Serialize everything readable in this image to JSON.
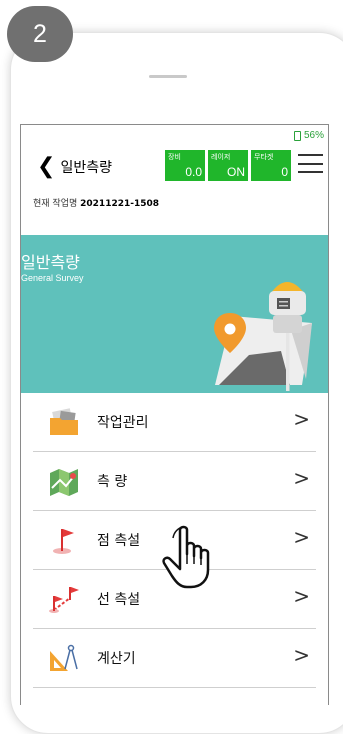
{
  "step_number": "2",
  "battery": {
    "percent": "56%"
  },
  "header": {
    "title": "일반측량",
    "back_icon": "chevron-left-icon",
    "menu_icon": "hamburger-icon"
  },
  "status": [
    {
      "label": "장비",
      "value": "0.0"
    },
    {
      "label": "레이저",
      "value": "ON"
    },
    {
      "label": "무타겟",
      "value": "0"
    }
  ],
  "job": {
    "label": "현재 작업명",
    "name": "20211221-1508"
  },
  "banner": {
    "title": "일반측량",
    "subtitle": "General Survey",
    "accent": "#5fc1bb"
  },
  "menu": [
    {
      "label": "작업관리",
      "icon": "folder-icon"
    },
    {
      "label": "측 량",
      "icon": "map-icon"
    },
    {
      "label": "점 측설",
      "icon": "point-flag-icon"
    },
    {
      "label": "선 측설",
      "icon": "line-flag-icon"
    },
    {
      "label": "계산기",
      "icon": "ruler-compass-icon"
    }
  ],
  "chevron": ">",
  "status_color": "#20b62b"
}
